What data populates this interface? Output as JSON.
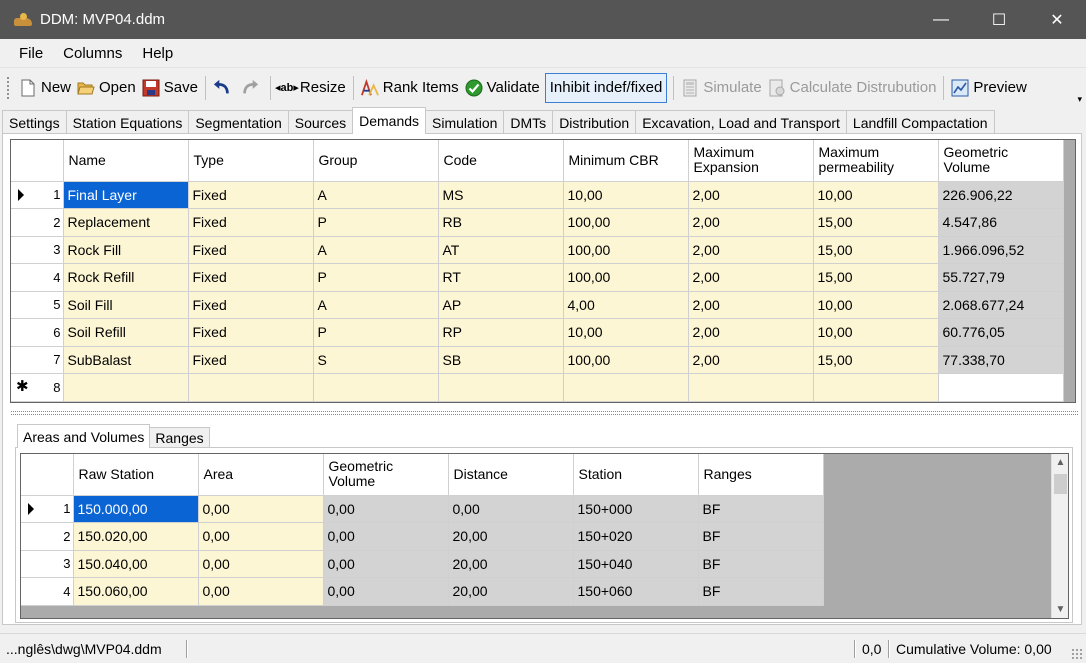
{
  "window": {
    "title": "DDM: MVP04.ddm",
    "minimize": "—",
    "maximize": "☐",
    "close": "✕"
  },
  "menu": [
    "File",
    "Columns",
    "Help"
  ],
  "toolbar": {
    "new": "New",
    "open": "Open",
    "save": "Save",
    "resize": "Resize",
    "rank_items": "Rank Items",
    "validate": "Validate",
    "inhibit": "Inhibit indef/fixed",
    "simulate": "Simulate",
    "calculate": "Calculate Distrubution",
    "preview": "Preview"
  },
  "tabs": [
    "Settings",
    "Station Equations",
    "Segmentation",
    "Sources",
    "Demands",
    "Simulation",
    "DMTs",
    "Distribution",
    "Excavation, Load and Transport",
    "Landfill Compactation"
  ],
  "active_tab": "Demands",
  "demands_grid": {
    "headers": {
      "name": "Name",
      "type": "Type",
      "group": "Group",
      "code": "Code",
      "min_cbr": "Minimum CBR",
      "max_exp_1": "Maximum",
      "max_exp_2": "Expansion",
      "max_perm_1": "Maximum",
      "max_perm_2": "permeability",
      "geo_vol_1": "Geometric",
      "geo_vol_2": "Volume"
    },
    "rows": [
      {
        "n": "1",
        "name": "Final Layer",
        "type": "Fixed",
        "group": "A",
        "code": "MS",
        "cbr": "10,00",
        "exp": "2,00",
        "perm": "10,00",
        "vol": "226.906,22"
      },
      {
        "n": "2",
        "name": "Replacement",
        "type": "Fixed",
        "group": "P",
        "code": "RB",
        "cbr": "100,00",
        "exp": "2,00",
        "perm": "15,00",
        "vol": "4.547,86"
      },
      {
        "n": "3",
        "name": "Rock Fill",
        "type": "Fixed",
        "group": "A",
        "code": "AT",
        "cbr": "100,00",
        "exp": "2,00",
        "perm": "15,00",
        "vol": "1.966.096,52"
      },
      {
        "n": "4",
        "name": "Rock Refill",
        "type": "Fixed",
        "group": "P",
        "code": "RT",
        "cbr": "100,00",
        "exp": "2,00",
        "perm": "15,00",
        "vol": "55.727,79"
      },
      {
        "n": "5",
        "name": "Soil Fill",
        "type": "Fixed",
        "group": "A",
        "code": "AP",
        "cbr": "4,00",
        "exp": "2,00",
        "perm": "10,00",
        "vol": "2.068.677,24"
      },
      {
        "n": "6",
        "name": "Soil Refill",
        "type": "Fixed",
        "group": "P",
        "code": "RP",
        "cbr": "10,00",
        "exp": "2,00",
        "perm": "10,00",
        "vol": "60.776,05"
      },
      {
        "n": "7",
        "name": "SubBalast",
        "type": "Fixed",
        "group": "S",
        "code": "SB",
        "cbr": "100,00",
        "exp": "2,00",
        "perm": "15,00",
        "vol": "77.338,70"
      }
    ],
    "new_row_number": "8"
  },
  "inner_tabs": [
    "Areas and Volumes",
    "Ranges"
  ],
  "areas_grid": {
    "headers": {
      "raw_station": "Raw Station",
      "area": "Area",
      "geo_vol_1": "Geometric",
      "geo_vol_2": "Volume",
      "distance": "Distance",
      "station": "Station",
      "ranges": "Ranges"
    },
    "rows": [
      {
        "n": "1",
        "raw": "150.000,00",
        "area": "0,00",
        "vol": "0,00",
        "dist": "0,00",
        "station": "150+000",
        "ranges": "BF"
      },
      {
        "n": "2",
        "raw": "150.020,00",
        "area": "0,00",
        "vol": "0,00",
        "dist": "20,00",
        "station": "150+020",
        "ranges": "BF"
      },
      {
        "n": "3",
        "raw": "150.040,00",
        "area": "0,00",
        "vol": "0,00",
        "dist": "20,00",
        "station": "150+040",
        "ranges": "BF"
      },
      {
        "n": "4",
        "raw": "150.060,00",
        "area": "0,00",
        "vol": "0,00",
        "dist": "20,00",
        "station": "150+060",
        "ranges": "BF"
      }
    ]
  },
  "status": {
    "path": "...nglês\\dwg\\MVP04.ddm",
    "coords": "0,0",
    "cumulative": "Cumulative Volume: 0,00"
  }
}
